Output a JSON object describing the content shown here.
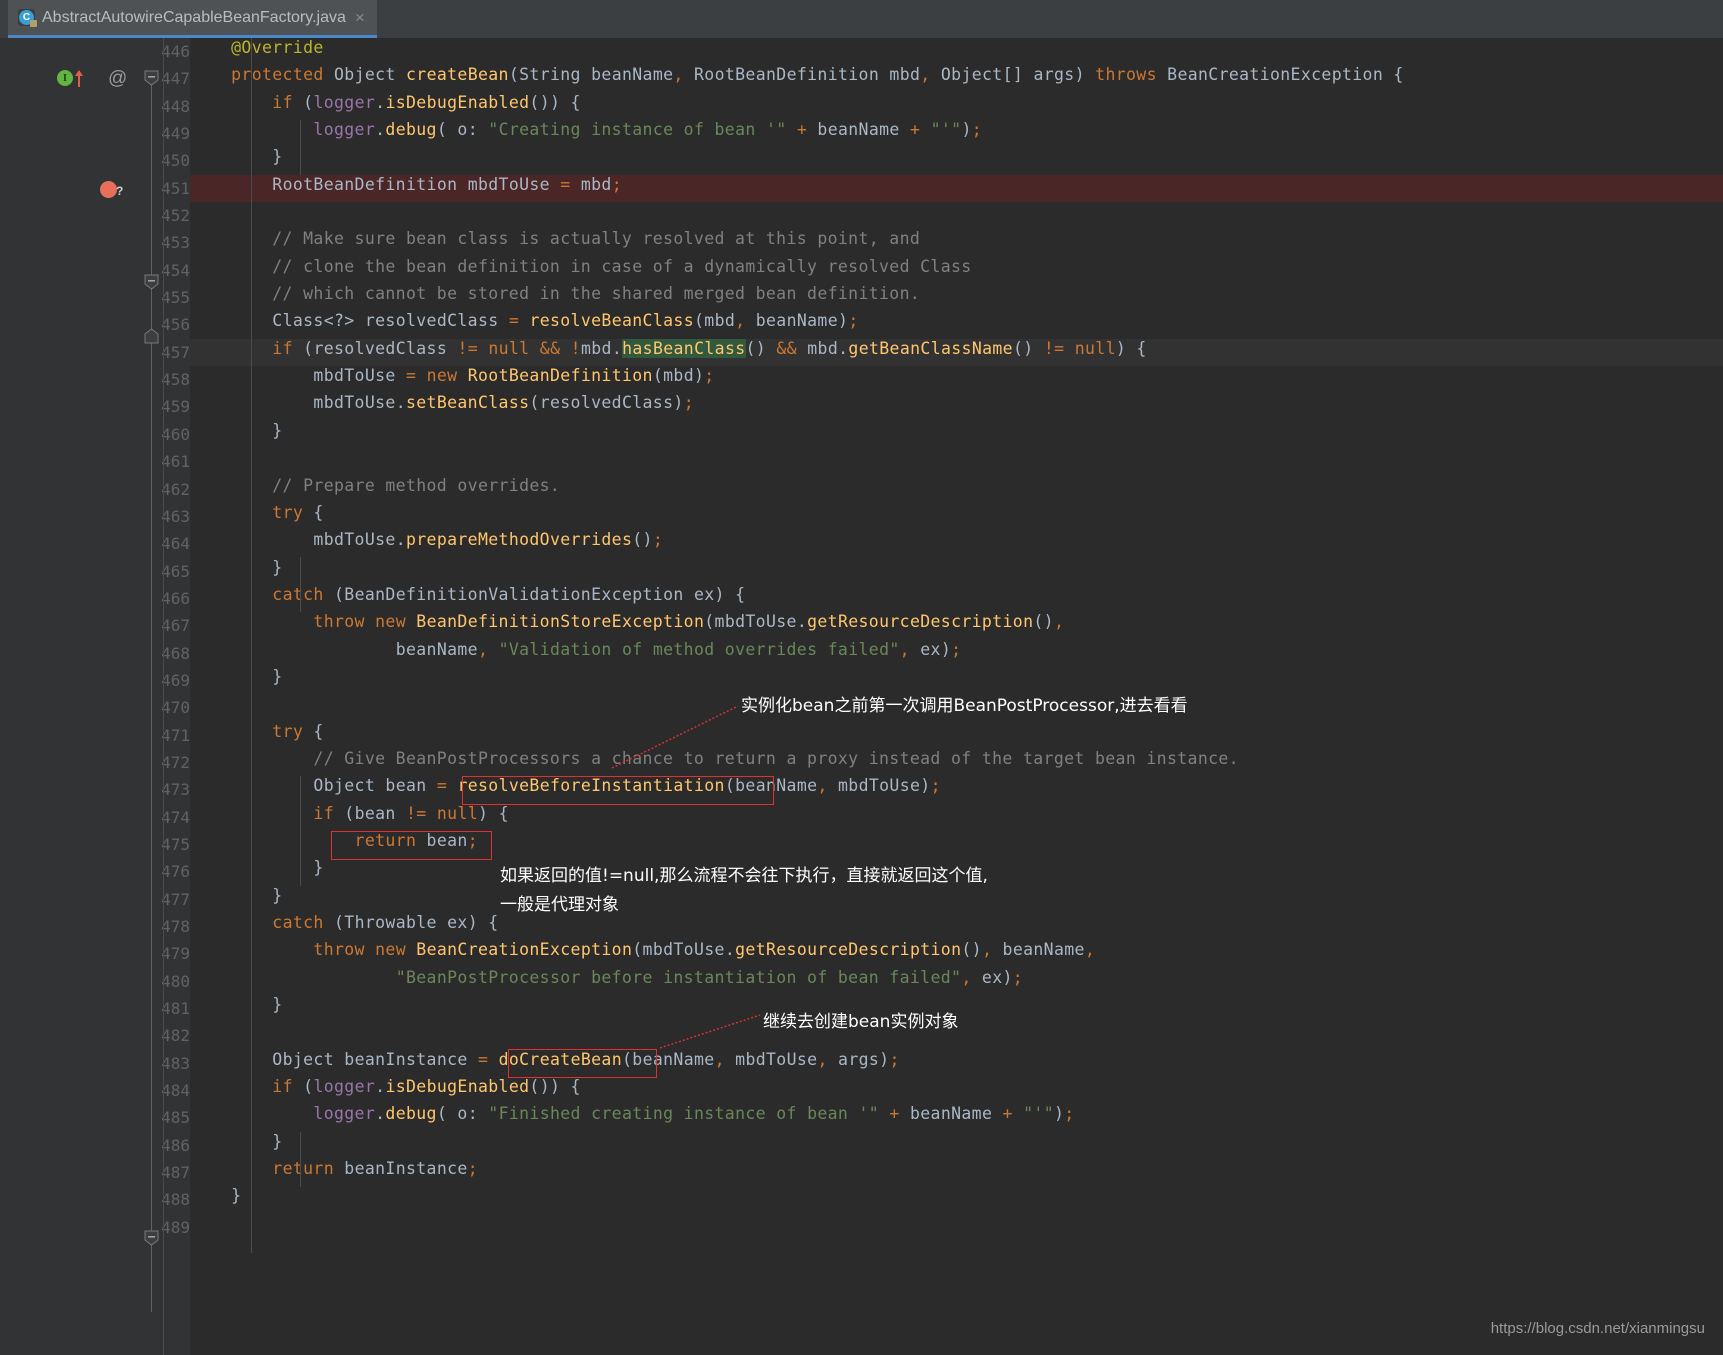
{
  "window": {
    "background_color": "#2b2b2b",
    "gutter_color": "#313335",
    "accent_color": "#4a88c7"
  },
  "tab": {
    "label": "AbstractAutowireCapableBeanFactory.java",
    "icon": "java-class-icon",
    "close_label": "×",
    "file_initial": "C"
  },
  "editor": {
    "first_line": 446,
    "last_line": 489,
    "breakpoint_line": 451,
    "caret_line": 457,
    "search_highlight": "hasBeanClass",
    "line_numbers": [
      "446",
      "447",
      "448",
      "449",
      "450",
      "451",
      "452",
      "453",
      "454",
      "455",
      "456",
      "457",
      "458",
      "459",
      "460",
      "461",
      "462",
      "463",
      "464",
      "465",
      "466",
      "467",
      "468",
      "469",
      "470",
      "471",
      "472",
      "473",
      "474",
      "475",
      "476",
      "477",
      "478",
      "479",
      "480",
      "481",
      "482",
      "483",
      "484",
      "485",
      "486",
      "487",
      "488",
      "489"
    ],
    "gutter_icons": {
      "run_method_icon": "I",
      "override_arrow_icon": "up-arrow",
      "annotation_icon": "@",
      "breakpoint_icon": "breakpoint-circle",
      "breakpoint_question": "?",
      "fold_icon": "fold-minus"
    },
    "code_lines": [
      "    @Override",
      "    protected Object createBean(String beanName, RootBeanDefinition mbd, Object[] args) throws BeanCreationException {",
      "        if (logger.isDebugEnabled()) {",
      "            logger.debug( o: \"Creating instance of bean '\" + beanName + \"'\");",
      "        }",
      "        RootBeanDefinition mbdToUse = mbd;",
      "",
      "        // Make sure bean class is actually resolved at this point, and",
      "        // clone the bean definition in case of a dynamically resolved Class",
      "        // which cannot be stored in the shared merged bean definition.",
      "        Class<?> resolvedClass = resolveBeanClass(mbd, beanName);",
      "        if (resolvedClass != null && !mbd.hasBeanClass() && mbd.getBeanClassName() != null) {",
      "            mbdToUse = new RootBeanDefinition(mbd);",
      "            mbdToUse.setBeanClass(resolvedClass);",
      "        }",
      "",
      "        // Prepare method overrides.",
      "        try {",
      "            mbdToUse.prepareMethodOverrides();",
      "        }",
      "        catch (BeanDefinitionValidationException ex) {",
      "            throw new BeanDefinitionStoreException(mbdToUse.getResourceDescription(),",
      "                    beanName, \"Validation of method overrides failed\", ex);",
      "        }",
      "",
      "        try {",
      "            // Give BeanPostProcessors a chance to return a proxy instead of the target bean instance.",
      "            Object bean = resolveBeforeInstantiation(beanName, mbdToUse);",
      "            if (bean != null) {",
      "                return bean;",
      "            }",
      "        }",
      "        catch (Throwable ex) {",
      "            throw new BeanCreationException(mbdToUse.getResourceDescription(), beanName,",
      "                    \"BeanPostProcessor before instantiation of bean failed\", ex);",
      "        }",
      "",
      "        Object beanInstance = doCreateBean(beanName, mbdToUse, args);",
      "        if (logger.isDebugEnabled()) {",
      "            logger.debug( o: \"Finished creating instance of bean '\" + beanName + \"'\");",
      "        }",
      "        return beanInstance;",
      "    }",
      ""
    ]
  },
  "annotations": {
    "color": "#e03030",
    "boxes": [
      {
        "name": "resolve-before-instantiation-box",
        "label": "resolveBeforeInstantiation"
      },
      {
        "name": "return-bean-box",
        "label": "return bean;"
      },
      {
        "name": "do-create-bean-box",
        "label": "doCreateBean"
      }
    ],
    "notes": [
      {
        "name": "note-bean-post-processor",
        "text": "实例化bean之前第一次调用BeanPostProcessor,进去看看"
      },
      {
        "name": "note-return-value-line1",
        "text": "如果返回的值!=null,那么流程不会往下执行，直接就返回这个值,"
      },
      {
        "name": "note-return-value-line2",
        "text": "一般是代理对象"
      },
      {
        "name": "note-do-create-bean",
        "text": "继续去创建bean实例对象"
      }
    ]
  },
  "watermark": {
    "text": "https://blog.csdn.net/xianmingsu"
  }
}
